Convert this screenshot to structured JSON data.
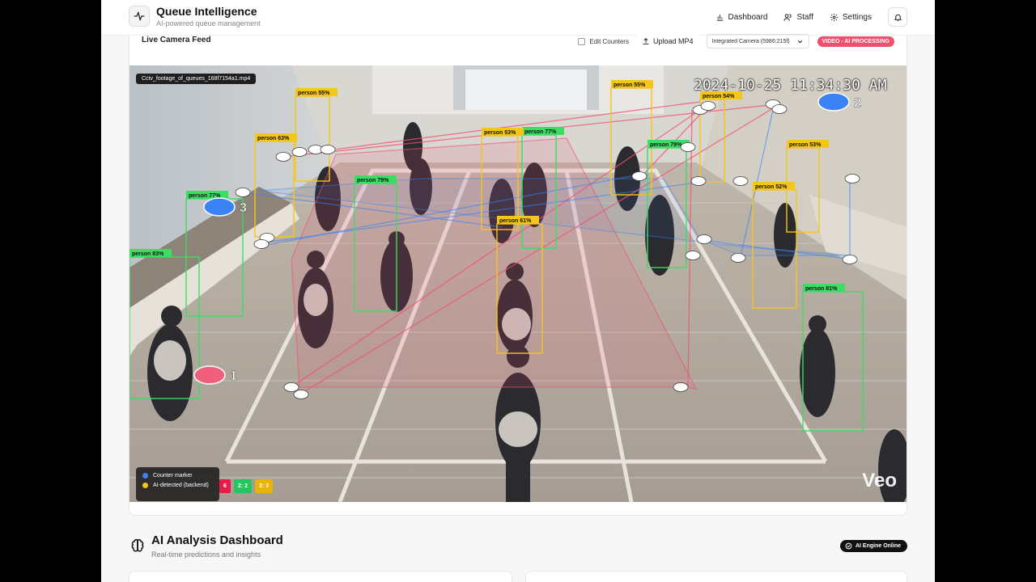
{
  "app": {
    "title": "Queue Intelligence",
    "subtitle": "AI-powered queue management"
  },
  "nav": {
    "dashboard": "Dashboard",
    "staff": "Staff",
    "settings": "Settings"
  },
  "feed": {
    "title": "Live Camera Feed",
    "edit_counters_label": "Edit Counters",
    "edit_counters_checked": false,
    "upload_label": "Upload MP4",
    "camera_select": "Integrated Camera (5986:215f)",
    "status_badge": "VIDEO - AI PROCESSING",
    "filename": "Cctv_footage_of_queues_168f7154a1.mp4",
    "timestamp": "2024-10-25 11:34:30 AM",
    "watermark": "Veo"
  },
  "detections": [
    {
      "label": "person 55%",
      "color": "#f5c518"
    },
    {
      "label": "person 55%",
      "color": "#f5c518"
    },
    {
      "label": "person 54%",
      "color": "#f5c518"
    },
    {
      "label": "person 63%",
      "color": "#f5c518"
    },
    {
      "label": "person 53%",
      "color": "#f5c518"
    },
    {
      "label": "person 77%",
      "color": "#3ddc64"
    },
    {
      "label": "person 79%",
      "color": "#3ddc64"
    },
    {
      "label": "person 53%",
      "color": "#f5c518"
    },
    {
      "label": "person 77%",
      "color": "#3ddc64"
    },
    {
      "label": "person 79%",
      "color": "#3ddc64"
    },
    {
      "label": "person 52%",
      "color": "#f5c518"
    },
    {
      "label": "person 61%",
      "color": "#f5c518"
    },
    {
      "label": "person 83%",
      "color": "#3ddc64"
    },
    {
      "label": "person 81%",
      "color": "#3ddc64"
    }
  ],
  "counters": [
    {
      "number": "1",
      "color": "#f0607a"
    },
    {
      "number": "2",
      "color": "#3b82f6"
    },
    {
      "number": "3",
      "color": "#3b82f6"
    }
  ],
  "legend": {
    "counter_marker": "Counter marker",
    "ai_detected": "AI-detected (backend)",
    "counter_marker_color": "#3b82f6",
    "ai_detected_color": "#f5c518"
  },
  "queue_chips": [
    {
      "label": "6",
      "color": "#e11d48"
    },
    {
      "label": "2: 2",
      "color": "#22c55e"
    },
    {
      "label": "3: 3",
      "color": "#eab308"
    }
  ],
  "dashboard": {
    "title": "AI Analysis Dashboard",
    "subtitle": "Real-time predictions and insights",
    "engine_status": "AI Engine Online"
  }
}
